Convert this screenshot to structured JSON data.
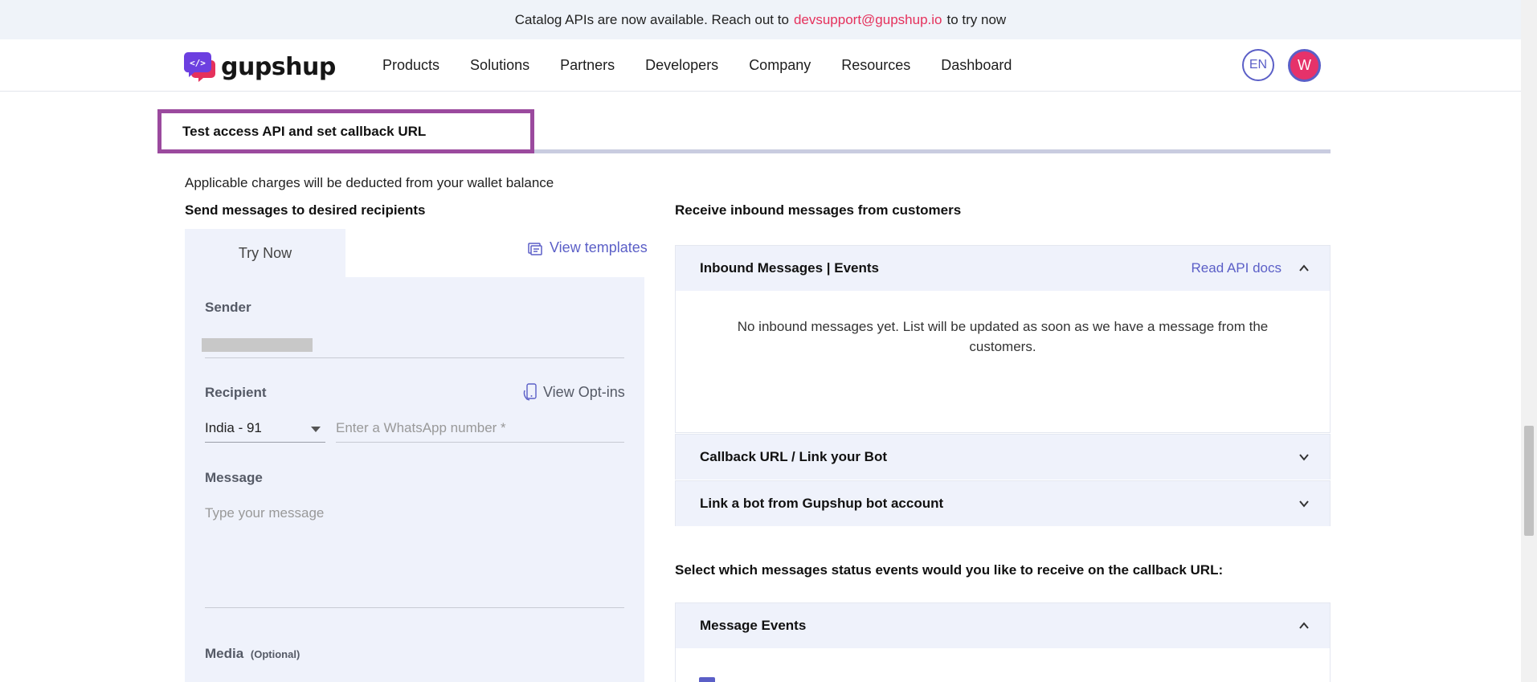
{
  "announcement": {
    "prefix": "Catalog APIs are now available. Reach out to",
    "email": "devsupport@gupshup.io",
    "suffix": "to try now"
  },
  "header": {
    "logo_text": "gupshup",
    "nav": [
      "Products",
      "Solutions",
      "Partners",
      "Developers",
      "Company",
      "Resources",
      "Dashboard"
    ],
    "lang": "EN",
    "avatar_initial": "W"
  },
  "section_tab": "Test access API and set callback URL",
  "charges_note": "Applicable charges will be deducted from your wallet balance",
  "send": {
    "heading": "Send messages to desired recipients",
    "tab_label": "Try Now",
    "view_templates": "View templates",
    "sender_label": "Sender",
    "recipient_label": "Recipient",
    "view_optins": "View Opt-ins",
    "country_value": "India - 91",
    "phone_placeholder": "Enter a WhatsApp number *",
    "message_label": "Message",
    "message_placeholder": "Type your message",
    "media_label": "Media",
    "media_optional": "(Optional)"
  },
  "receive": {
    "heading": "Receive inbound messages from customers",
    "inbound_title": "Inbound Messages | Events",
    "read_api_docs": "Read API docs",
    "empty_message": "No inbound messages yet. List will be updated as soon as we have a message from the customers.",
    "callback_title": "Callback URL / Link your Bot",
    "link_bot_title": "Link a bot from Gupshup bot account",
    "status_question": "Select which messages status events would you like to receive on the callback URL:",
    "message_events_title": "Message Events"
  },
  "colors": {
    "accent": "#5b5fc7",
    "brand_pink": "#e5315c",
    "highlight_border": "#9b4a9e",
    "panel_bg": "#eff2fb"
  }
}
